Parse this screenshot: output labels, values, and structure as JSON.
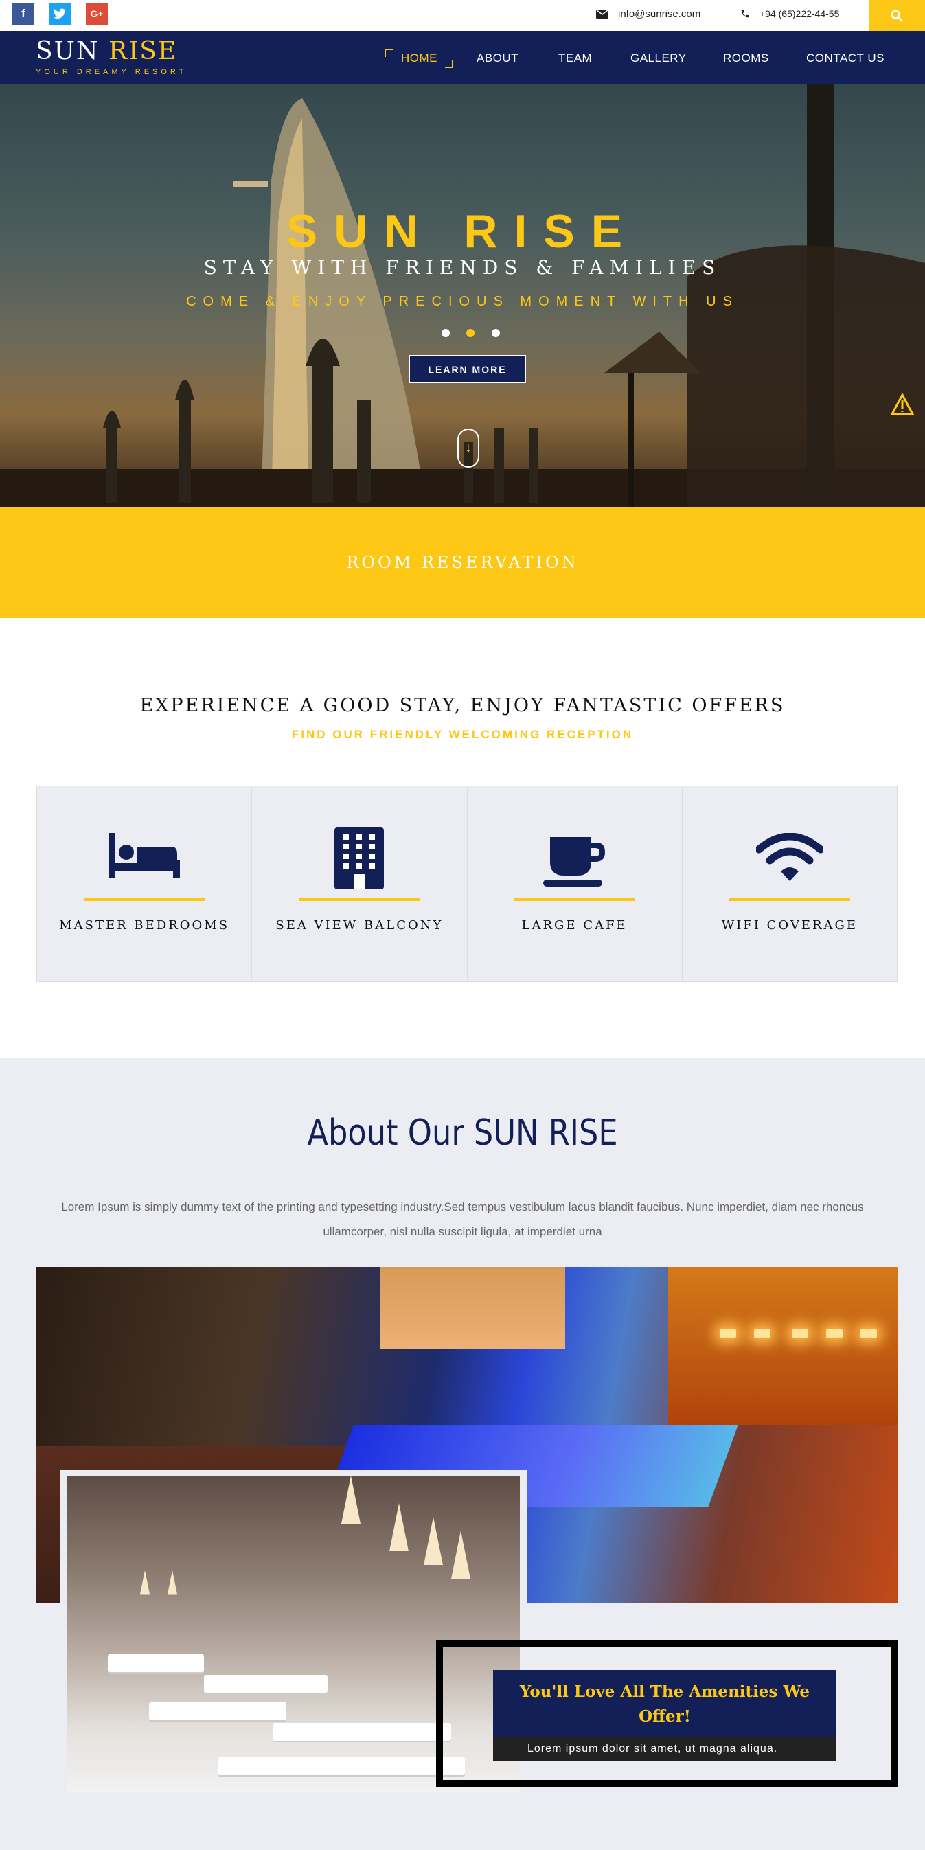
{
  "topbar": {
    "social": [
      {
        "name": "facebook",
        "glyph": "f"
      },
      {
        "name": "twitter",
        "glyph": "t"
      },
      {
        "name": "google-plus",
        "glyph": "G+"
      }
    ],
    "email": "info@sunrise.com",
    "phone": "+94 (65)222-44-55",
    "search_icon": "search-icon"
  },
  "nav": {
    "logo_part1": "SUN",
    "logo_part2": "RISE",
    "tagline": "YOUR DREAMY RESORT",
    "items": [
      "HOME",
      "ABOUT",
      "TEAM",
      "GALLERY",
      "ROOMS",
      "CONTACT US"
    ],
    "active": "HOME"
  },
  "hero": {
    "title": "SUN RISE",
    "subtitle": "STAY WITH FRIENDS & FAMILIES",
    "tagline": "COME & ENJOY PRECIOUS MOMENT WITH US",
    "button": "LEARN MORE",
    "scroll_glyph": "↓",
    "active_slide": 2,
    "slides": 3
  },
  "reservation": {
    "label": "ROOM RESERVATION"
  },
  "offers": {
    "title": "EXPERIENCE A GOOD STAY, ENJOY FANTASTIC OFFERS",
    "subtitle": "FIND OUR FRIENDLY WELCOMING RECEPTION",
    "features": [
      {
        "label": "MASTER BEDROOMS",
        "icon": "bed-icon"
      },
      {
        "label": "SEA VIEW BALCONY",
        "icon": "building-icon"
      },
      {
        "label": "LARGE CAFE",
        "icon": "coffee-cup-icon"
      },
      {
        "label": "WIFI COVERAGE",
        "icon": "wifi-icon"
      }
    ]
  },
  "about": {
    "title": "About Our SUN RISE",
    "text": "Lorem Ipsum is simply dummy text of the printing and typesetting industry.Sed tempus vestibulum lacus blandit faucibus. Nunc imperdiet, diam nec rhoncus ullamcorper, nisl nulla suscipit ligula, at imperdiet urna",
    "promo_title": "You'll Love All The Amenities We Offer!",
    "promo_text": "Lorem ipsum dolor sit amet, ut magna aliqua."
  },
  "colors": {
    "navy": "#132057",
    "yellow": "#fdc716",
    "light_bg": "#ecedf2"
  }
}
